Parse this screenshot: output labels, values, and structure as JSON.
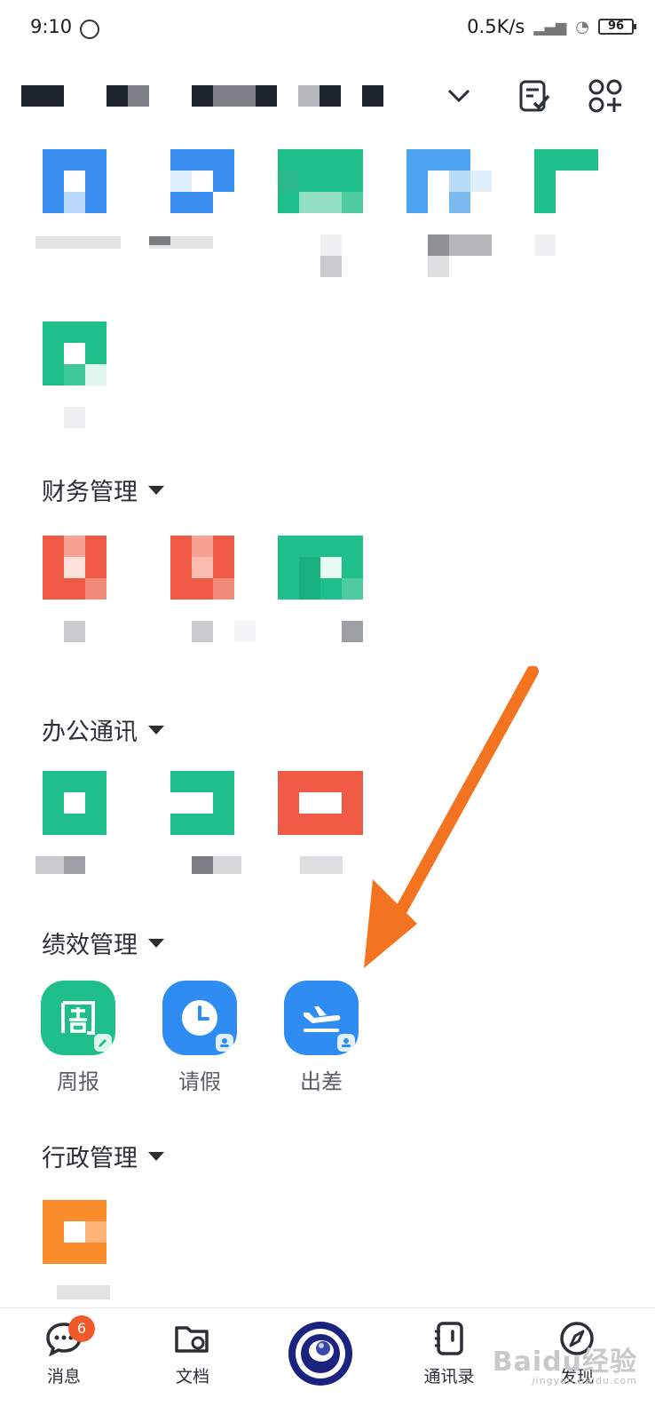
{
  "status_bar": {
    "time": "9:10",
    "network_speed": "0.5K/s",
    "battery": "96"
  },
  "sections": {
    "finance": "财务管理",
    "office": "办公通讯",
    "performance": "绩效管理",
    "admin": "行政管理"
  },
  "apps": {
    "weekly_report": "周报",
    "leave": "请假",
    "business_trip": "出差"
  },
  "bottom_nav": {
    "messages": "消息",
    "messages_badge": "6",
    "docs": "文档",
    "contacts": "通讯录",
    "discover": "发现"
  },
  "watermark": {
    "brand": "Baidu经验",
    "url": "jingyan.baidu.com"
  },
  "colors": {
    "green": "#1fbf8b",
    "blue": "#2f8cf2",
    "red": "#ef5a45",
    "orange": "#fc8d2c",
    "arrow": "#f47320"
  }
}
